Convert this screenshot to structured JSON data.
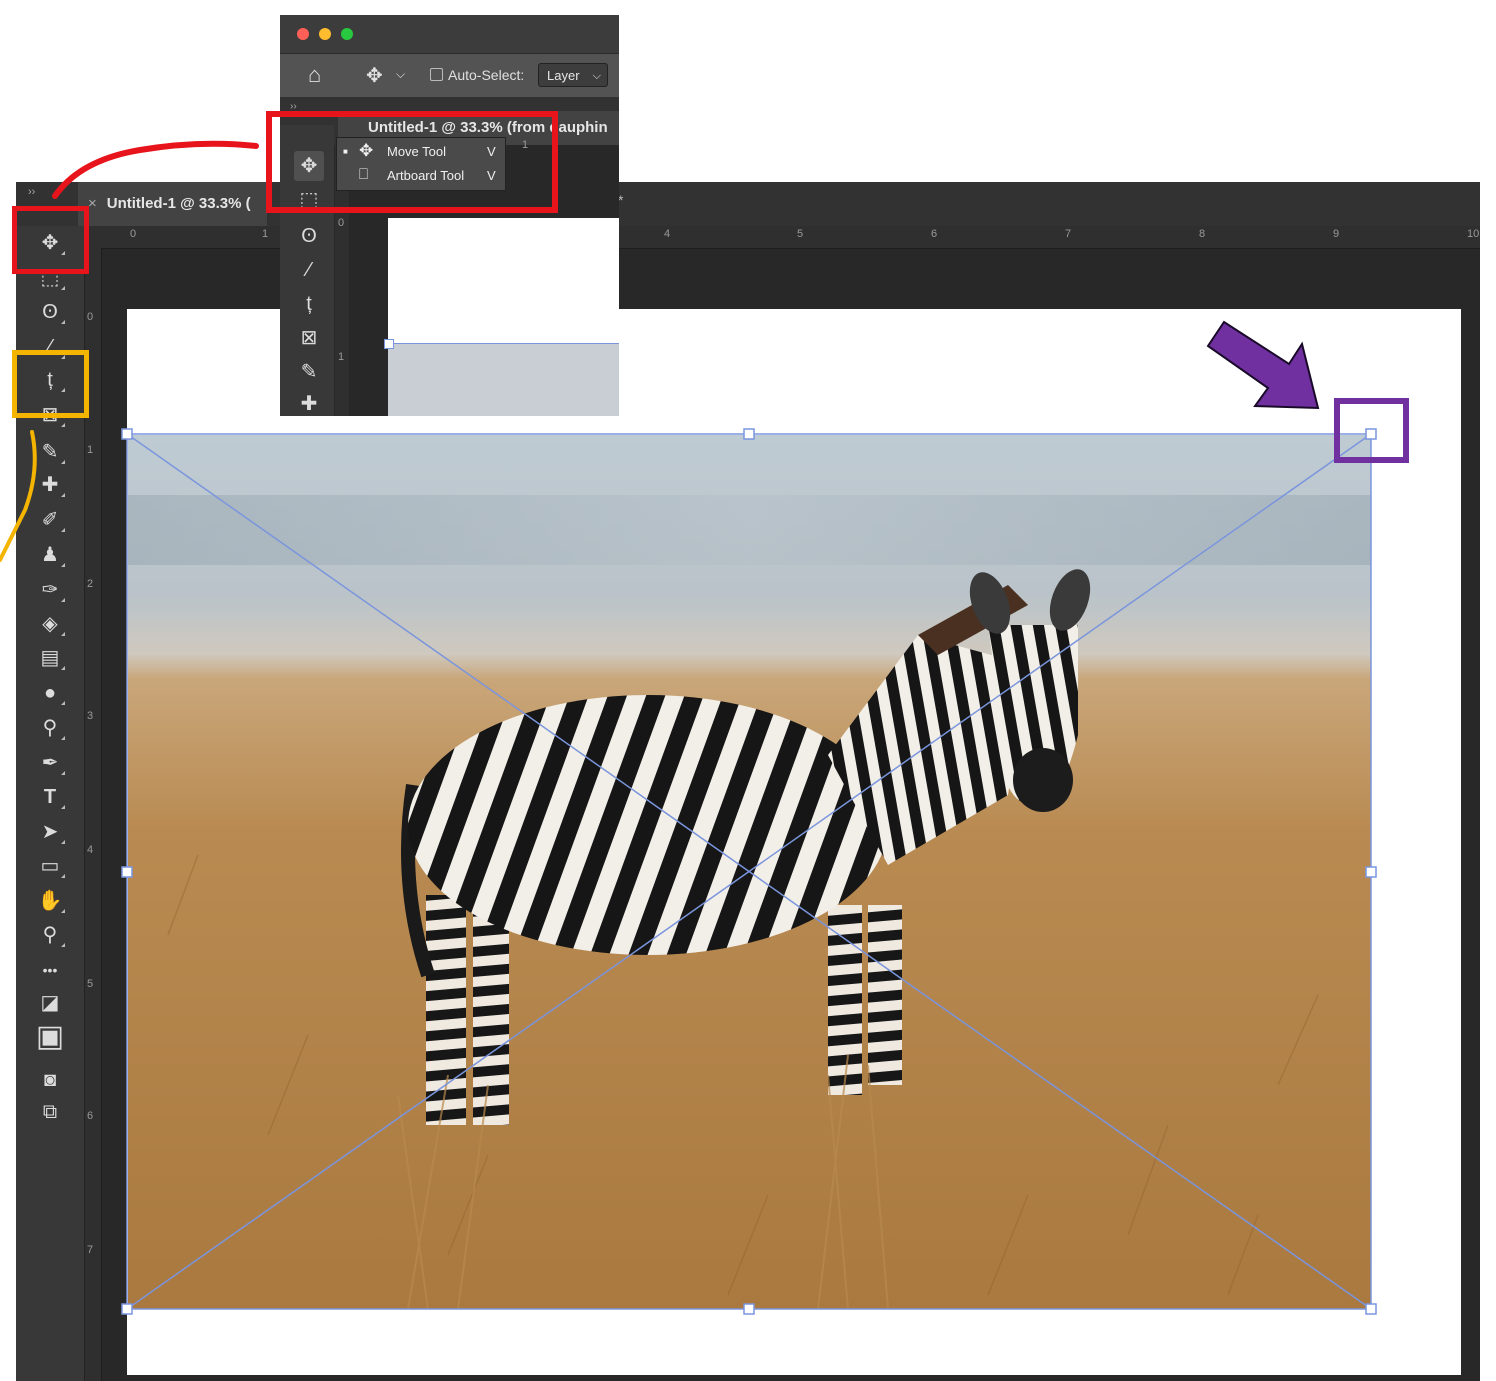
{
  "document_tab": {
    "close": "×",
    "title": "Untitled-1 @ 33.3% (",
    "modified_marker": "*"
  },
  "panel_collapse": "››",
  "ruler": {
    "horizontal": [
      "0",
      "1",
      "4",
      "5",
      "6",
      "7",
      "8",
      "9",
      "10"
    ],
    "vertical": [
      "0",
      "1",
      "2",
      "3",
      "4",
      "5",
      "6",
      "7"
    ]
  },
  "inset": {
    "options_bar": {
      "auto_select_label": "Auto-Select:",
      "layer_select": "Layer"
    },
    "doc_tab_title": "Untitled-1 @ 33.3% (from dauphin",
    "ruler_vertical": [
      "0",
      "1"
    ],
    "ruler_horizontal": [
      "1"
    ],
    "flyout": [
      {
        "label": "Move Tool",
        "shortcut": "V",
        "icon": "move-icon",
        "selected": true
      },
      {
        "label": "Artboard Tool",
        "shortcut": "V",
        "icon": "artboard-icon",
        "selected": false
      }
    ]
  },
  "tools": [
    {
      "name": "move-tool",
      "glyph": "✥"
    },
    {
      "name": "marquee-tool",
      "glyph": "⬚"
    },
    {
      "name": "lasso-tool",
      "glyph": "ʘ"
    },
    {
      "name": "magic-wand-tool",
      "glyph": "⁄"
    },
    {
      "name": "crop-tool",
      "glyph": "ț"
    },
    {
      "name": "frame-tool",
      "glyph": "⊠"
    },
    {
      "name": "eyedropper-tool",
      "glyph": "✎"
    },
    {
      "name": "healing-brush-tool",
      "glyph": "✚"
    },
    {
      "name": "brush-tool",
      "glyph": "✐"
    },
    {
      "name": "stamp-tool",
      "glyph": "♟"
    },
    {
      "name": "history-brush-tool",
      "glyph": "✑"
    },
    {
      "name": "eraser-tool",
      "glyph": "◈"
    },
    {
      "name": "gradient-tool",
      "glyph": "▤"
    },
    {
      "name": "blur-tool",
      "glyph": "●"
    },
    {
      "name": "dodge-tool",
      "glyph": "⚲"
    },
    {
      "name": "pen-tool",
      "glyph": "✒"
    },
    {
      "name": "type-tool",
      "glyph": "T"
    },
    {
      "name": "path-selection-tool",
      "glyph": "➤"
    },
    {
      "name": "rectangle-tool",
      "glyph": "▭"
    },
    {
      "name": "hand-tool",
      "glyph": "✋"
    },
    {
      "name": "zoom-tool",
      "glyph": "⚲"
    },
    {
      "name": "more-tools",
      "glyph": "•••"
    },
    {
      "name": "default-colors",
      "glyph": "◪"
    },
    {
      "name": "foreground-background-colors",
      "glyph": "▣"
    },
    {
      "name": "quick-mask",
      "glyph": "◙"
    },
    {
      "name": "screen-mode",
      "glyph": "⧉"
    }
  ],
  "colors": {
    "annotation_red": "#e8141c",
    "annotation_orange": "#f5b400",
    "annotation_purple": "#7030a0",
    "selection_blue": "#7a95dd",
    "panel_dark": "#383838",
    "canvas_dark": "#282828"
  }
}
